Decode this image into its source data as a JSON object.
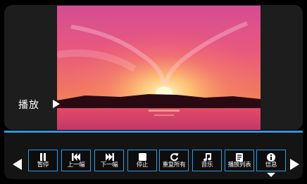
{
  "player": {
    "now_label": "播放"
  },
  "controls": [
    {
      "icon": "pause-icon",
      "label": "暂停"
    },
    {
      "icon": "previous-track-icon",
      "label": "上一幅"
    },
    {
      "icon": "next-track-icon",
      "label": "下一幅"
    },
    {
      "icon": "stop-icon",
      "label": "停止"
    },
    {
      "icon": "repeat-all-icon",
      "label": "重复所有"
    },
    {
      "icon": "music-note-icon",
      "label": "音乐"
    },
    {
      "icon": "playlist-icon",
      "label": "播放列表"
    },
    {
      "icon": "info-icon",
      "label": "信息"
    }
  ],
  "colors": {
    "accent": "#2e9ae0",
    "background": "#000000"
  }
}
